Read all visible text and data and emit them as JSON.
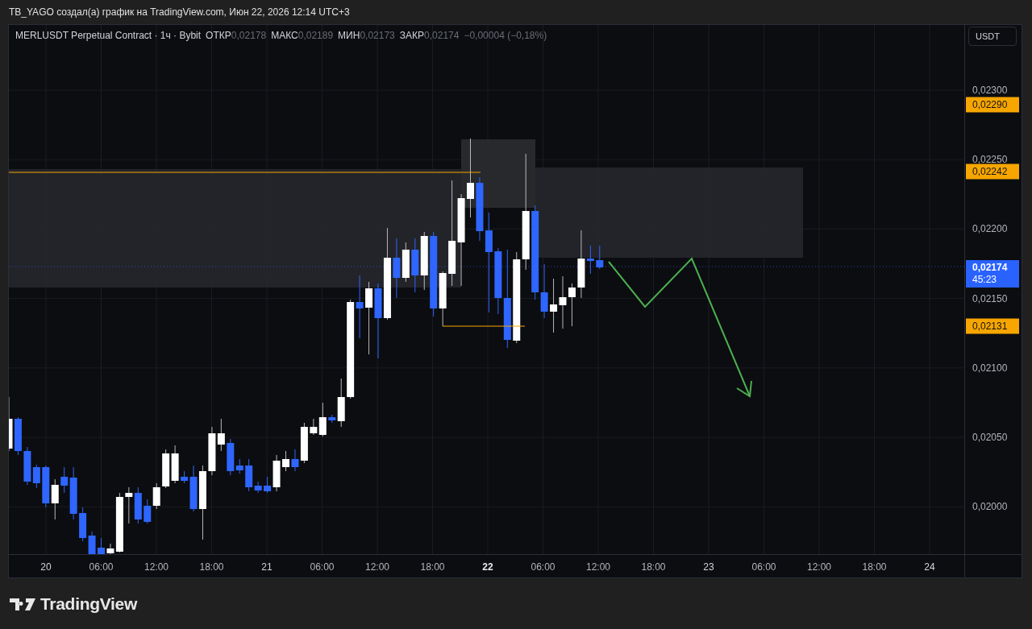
{
  "header": {
    "title": "TB_YAGO создал(а) график на TradingView.com, Июн 22, 2026 12:14 UTC+3"
  },
  "legend": {
    "symbol": "MERLUSDT Perpetual Contract · 1ч · Bybit",
    "ohlc": [
      {
        "label": "ОТКР",
        "value": "0,02178"
      },
      {
        "label": "МАКС",
        "value": "0,02189"
      },
      {
        "label": "МИН",
        "value": "0,02173"
      },
      {
        "label": "ЗАКР",
        "value": "0,02174"
      }
    ],
    "change": "−0,00004 (−0,18%)"
  },
  "currency_button": "USDT",
  "price_axis": {
    "ticks": [
      "0,02300",
      "0,02250",
      "0,02200",
      "0,02150",
      "0,02100",
      "0,02050",
      "0,02000"
    ],
    "labels": [
      {
        "kind": "level",
        "value": "0,02290"
      },
      {
        "kind": "level",
        "value": "0,02242"
      },
      {
        "kind": "current",
        "value": "0,02174",
        "countdown": "45:23"
      },
      {
        "kind": "level",
        "value": "0,02131"
      }
    ]
  },
  "time_axis": {
    "labels": [
      {
        "kind": "day",
        "text": "20"
      },
      {
        "kind": "time",
        "text": "06:00"
      },
      {
        "kind": "time",
        "text": "12:00"
      },
      {
        "kind": "time",
        "text": "18:00"
      },
      {
        "kind": "day",
        "text": "21"
      },
      {
        "kind": "time",
        "text": "06:00"
      },
      {
        "kind": "time",
        "text": "12:00"
      },
      {
        "kind": "time",
        "text": "18:00"
      },
      {
        "kind": "today",
        "text": "22"
      },
      {
        "kind": "time",
        "text": "06:00"
      },
      {
        "kind": "time",
        "text": "12:00"
      },
      {
        "kind": "time",
        "text": "18:00"
      },
      {
        "kind": "day",
        "text": "23"
      },
      {
        "kind": "time",
        "text": "06:00"
      },
      {
        "kind": "time",
        "text": "12:00"
      },
      {
        "kind": "time",
        "text": "18:00"
      },
      {
        "kind": "day",
        "text": "24"
      }
    ]
  },
  "logo": {
    "text": "TradingView"
  }
}
